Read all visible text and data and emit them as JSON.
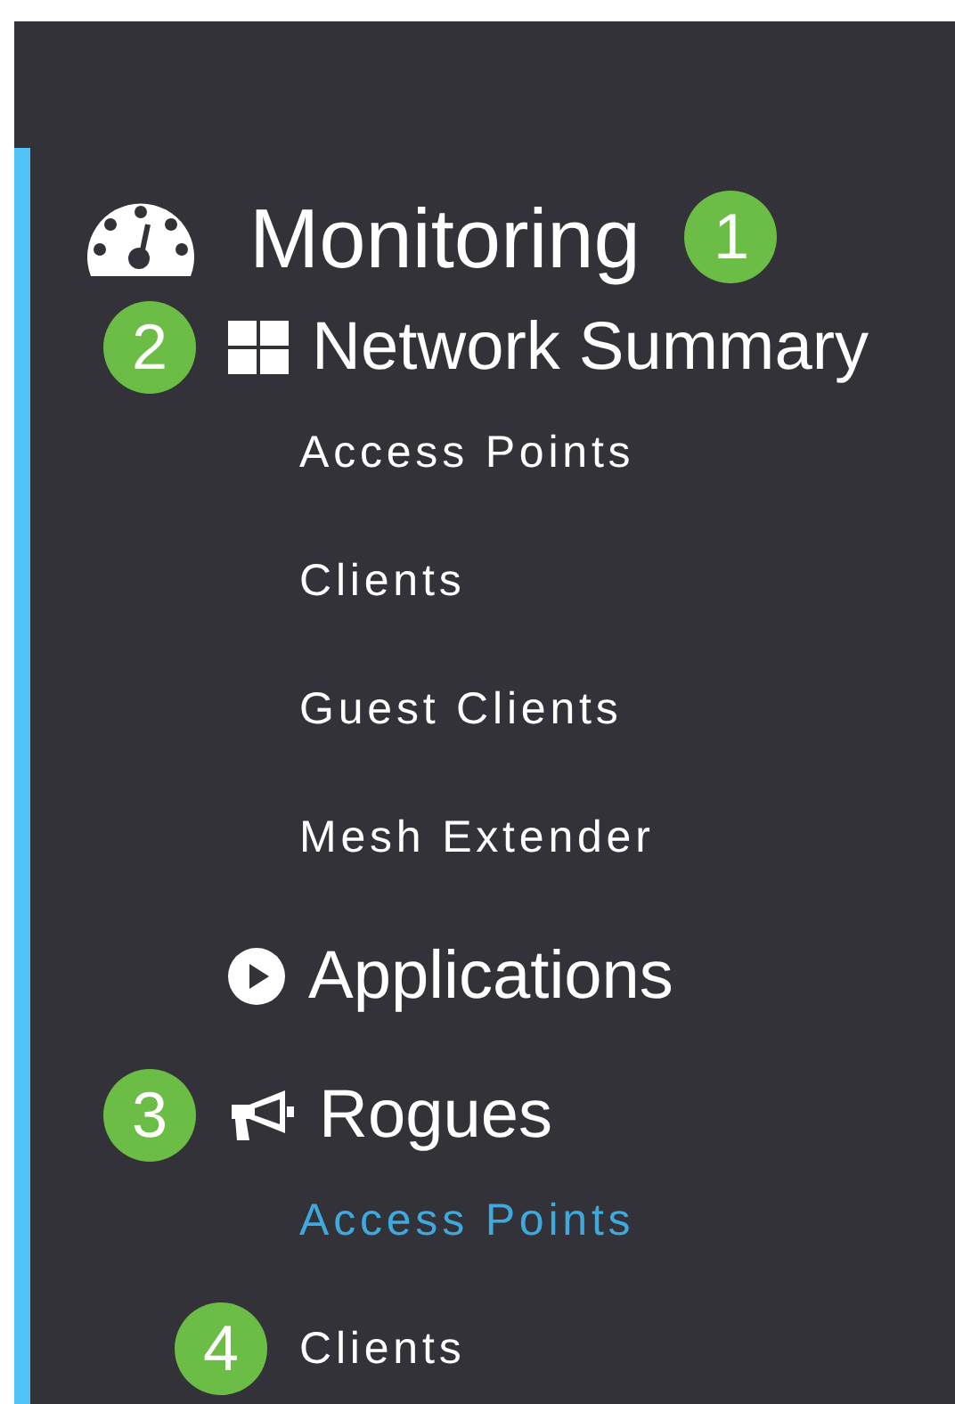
{
  "sidebar": {
    "items": [
      {
        "label": "Monitoring",
        "kind": "section",
        "callout": "1",
        "children": [
          {
            "label": "Network Summary",
            "kind": "group",
            "callout": "2",
            "children": [
              {
                "label": "Access Points",
                "kind": "leaf",
                "selected": false
              },
              {
                "label": "Clients",
                "kind": "leaf",
                "selected": false
              },
              {
                "label": "Guest Clients",
                "kind": "leaf",
                "selected": false
              },
              {
                "label": "Mesh Extender",
                "kind": "leaf",
                "selected": false
              }
            ]
          },
          {
            "label": "Applications",
            "kind": "group"
          },
          {
            "label": "Rogues",
            "kind": "group",
            "callout": "3",
            "children": [
              {
                "label": "Access Points",
                "kind": "leaf",
                "selected": true
              },
              {
                "label": "Clients",
                "kind": "leaf",
                "selected": false,
                "callout": "4"
              }
            ]
          }
        ]
      }
    ]
  }
}
